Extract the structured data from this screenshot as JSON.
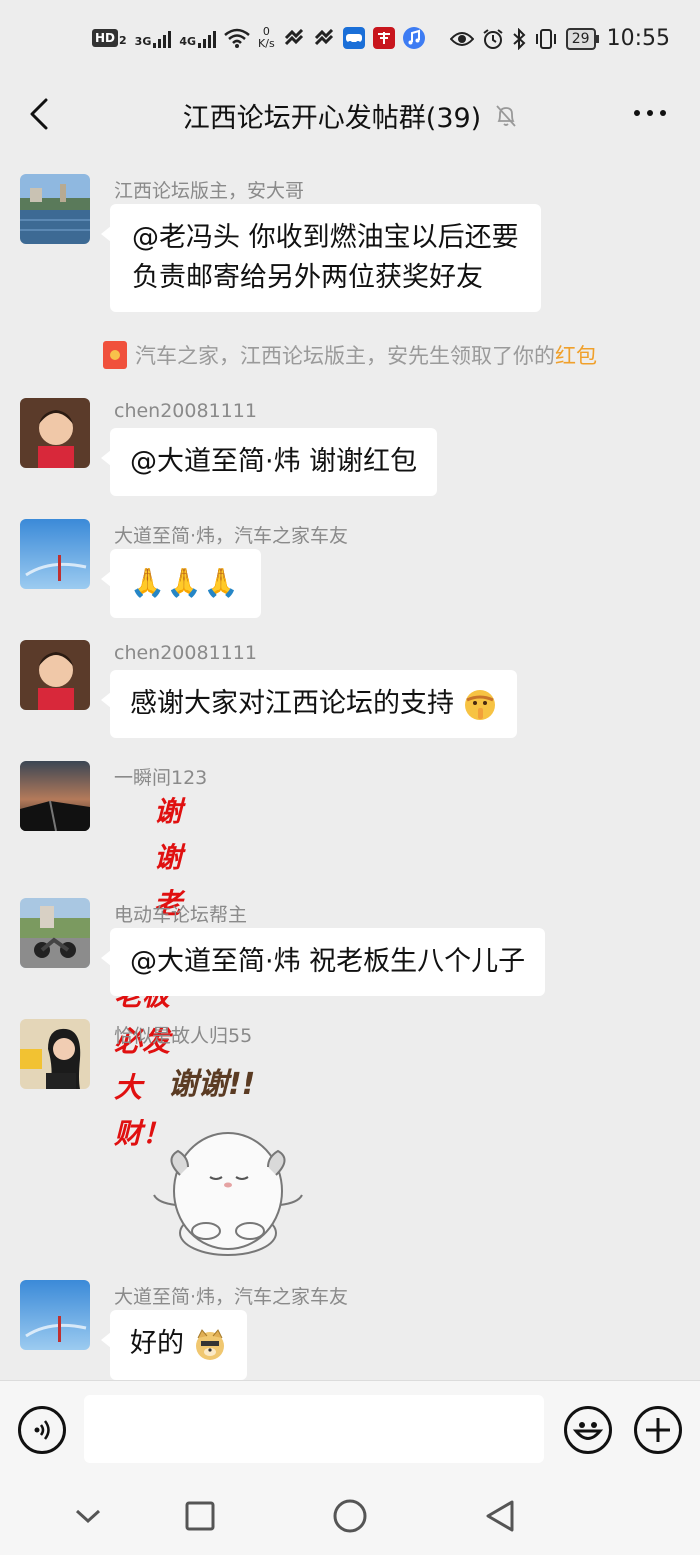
{
  "status_bar": {
    "hd_label": "HD",
    "sim_slot": "2",
    "net_3g": "3G",
    "net_4g": "4G",
    "speed_value": "0",
    "speed_unit": "K/s",
    "battery": "29",
    "time": "10:55"
  },
  "header": {
    "title": "江西论坛开心发帖群(39)"
  },
  "messages": [
    {
      "sender": "江西论坛版主，安大哥",
      "text_line1": "@老冯头  你收到燃油宝以后还要",
      "text_line2": "负责邮寄给另外两位获奖好友"
    },
    {
      "sender": "chen20081111",
      "text": "@大道至简·炜  谢谢红包"
    },
    {
      "sender": "大道至简·炜，汽车之家车友",
      "text": "🙏🙏🙏"
    },
    {
      "sender": "chen20081111",
      "text": "感谢大家对江西论坛的支持"
    },
    {
      "sender": "一瞬间123",
      "sticker_line1": "谢谢老板",
      "sticker_line2": "老板必发大财！"
    },
    {
      "sender": "电动车论坛帮主",
      "text": "@大道至简·炜  祝老板生八个儿子"
    },
    {
      "sender": "恰似是故人归55",
      "sticker_text": "谢谢!!"
    },
    {
      "sender": "大道至简·炜，汽车之家车友",
      "text": "好的"
    }
  ],
  "system_message": {
    "text": "汽车之家，江西论坛版主，安先生领取了你的",
    "link": "红包"
  },
  "colors": {
    "background": "#ededed",
    "bubble": "#ffffff",
    "sender": "#8a8a8a",
    "link_orange": "#f0a02b",
    "sticker_red": "#e01010"
  },
  "icons": {
    "back": "chevron-left-icon",
    "mute": "bell-off-icon",
    "more": "more-dots-icon",
    "voice": "voice-icon",
    "emoji": "smiley-icon",
    "plus": "plus-icon"
  }
}
